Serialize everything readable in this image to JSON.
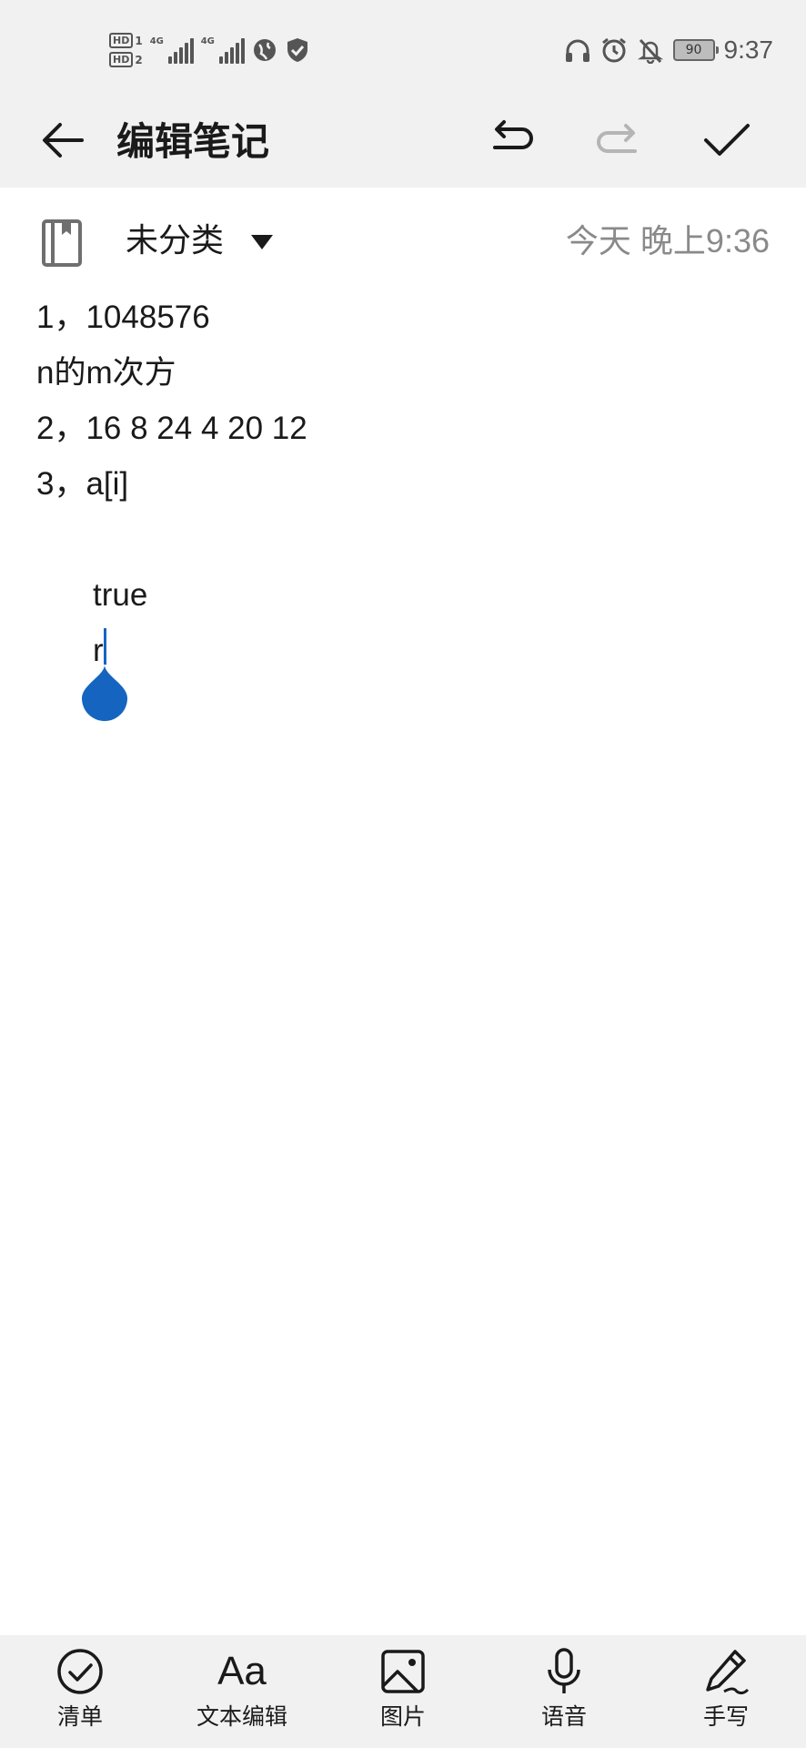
{
  "status_bar": {
    "sim1_label": "HD",
    "sim1_slot": "1",
    "sim2_label": "HD",
    "sim2_slot": "2",
    "net1": "4G",
    "net2": "4G",
    "battery": "90",
    "time": "9:37"
  },
  "app_bar": {
    "title": "编辑笔记"
  },
  "note_meta": {
    "category": "未分类",
    "date": "今天 晚上9:36"
  },
  "note_lines": [
    "1，1048576",
    "n的m次方",
    "2，16 8 24 4 20 12",
    "3，a[i]",
    "",
    "true",
    "r"
  ],
  "bottom_bar": {
    "checklist": "清单",
    "text_edit": "文本编辑",
    "text_edit_glyph": "Aa",
    "image": "图片",
    "voice": "语音",
    "handwriting": "手写"
  },
  "colors": {
    "accent": "#1565c0",
    "bar_background": "#f1f1f1",
    "date_gray": "#8a8a8a"
  }
}
